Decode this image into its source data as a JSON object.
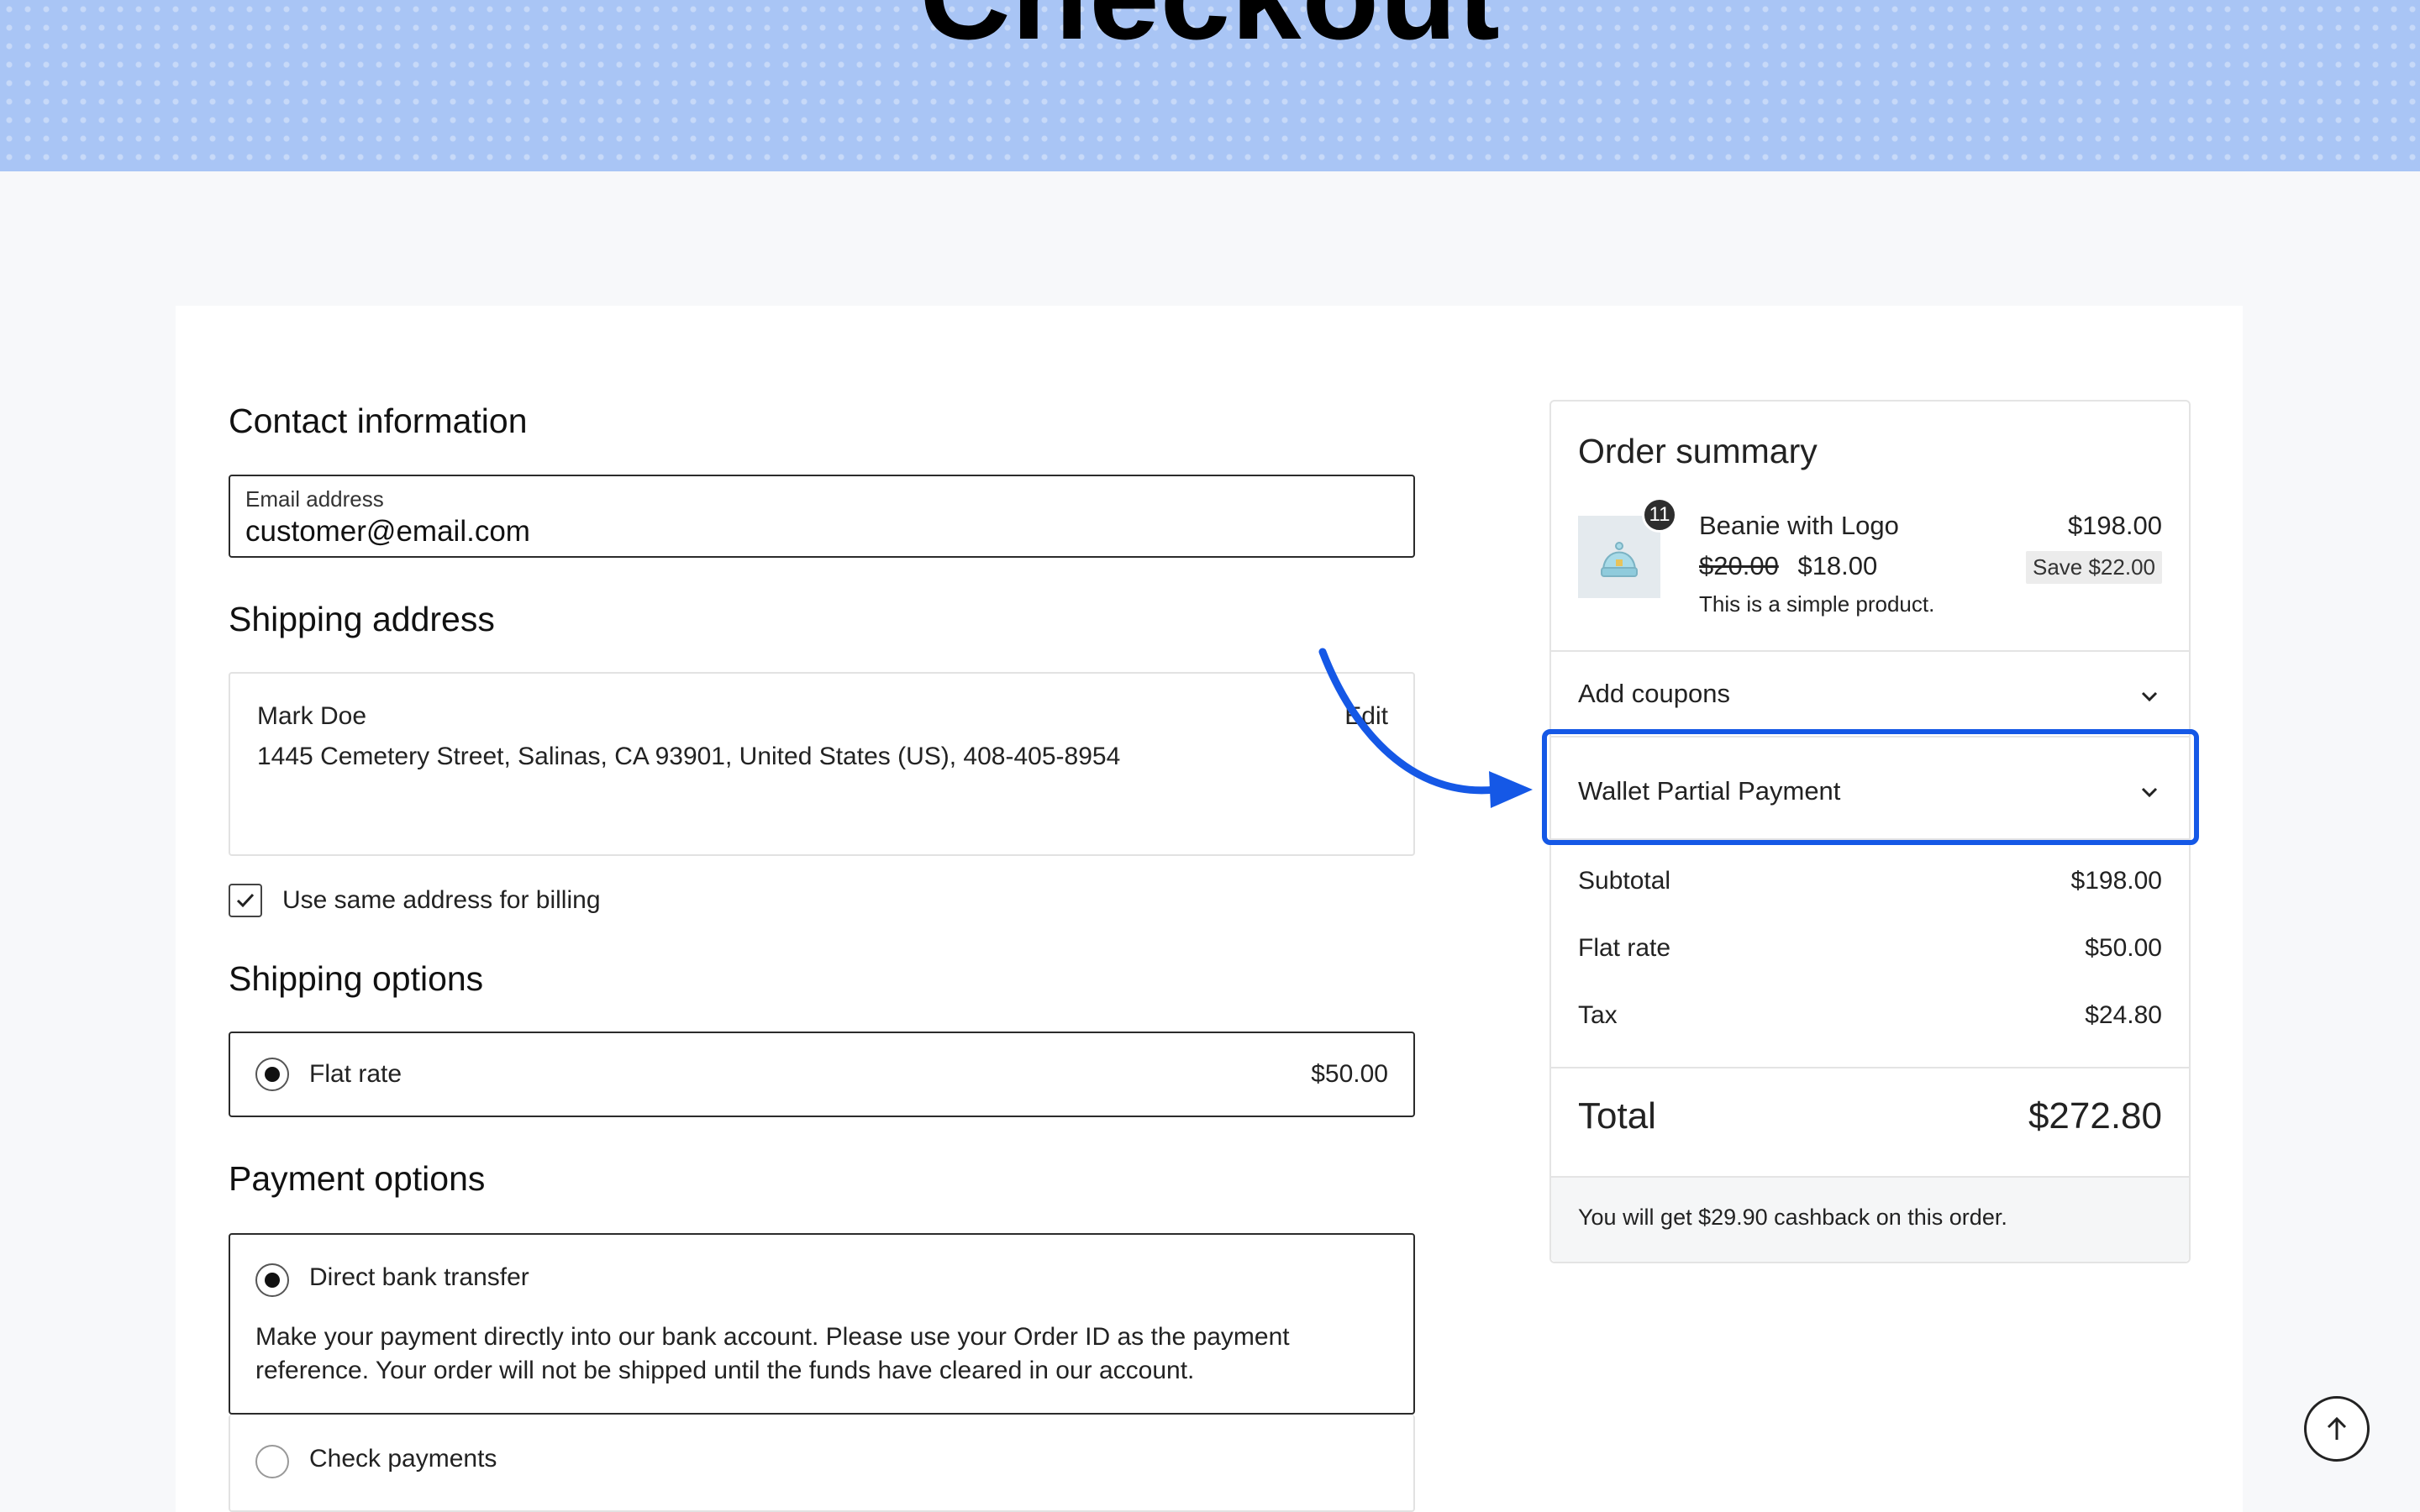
{
  "page": {
    "title": "Checkout"
  },
  "contact": {
    "heading": "Contact information",
    "email_label": "Email address",
    "email_value": "customer@email.com"
  },
  "shipping_address": {
    "heading": "Shipping address",
    "name": "Mark Doe",
    "line": "1445 Cemetery Street, Salinas, CA 93901, United States (US), 408-405-8954",
    "edit_label": "Edit"
  },
  "billing": {
    "same_address_label": "Use same address for billing",
    "checked": true
  },
  "shipping_options": {
    "heading": "Shipping options",
    "options": [
      {
        "label": "Flat rate",
        "price": "$50.00",
        "selected": true
      }
    ]
  },
  "payment_options": {
    "heading": "Payment options",
    "options": [
      {
        "label": "Direct bank transfer",
        "selected": true,
        "description": "Make your payment directly into our bank account. Please use your Order ID as the payment reference. Your order will not be shipped until the funds have cleared in our account."
      },
      {
        "label": "Check payments",
        "selected": false
      }
    ]
  },
  "summary": {
    "title": "Order summary",
    "item": {
      "quantity": "11",
      "name": "Beanie with Logo",
      "original_price": "$20.00",
      "price": "$18.00",
      "line_total": "$198.00",
      "save": "Save $22.00",
      "description": "This is a simple product."
    },
    "panels": {
      "coupons": "Add coupons",
      "wallet": "Wallet Partial Payment"
    },
    "totals": [
      {
        "label": "Subtotal",
        "value": "$198.00"
      },
      {
        "label": "Flat rate",
        "value": "$50.00"
      },
      {
        "label": "Tax",
        "value": "$24.80"
      }
    ],
    "total_label": "Total",
    "total_value": "$272.80",
    "cashback": "You will get $29.90 cashback on this order."
  },
  "colors": {
    "hero": "#a9c5f5",
    "highlight": "#1558e6"
  },
  "icons": {
    "chevron": "chevron-down-icon",
    "check": "check-icon",
    "scroll_top": "arrow-up-icon"
  }
}
